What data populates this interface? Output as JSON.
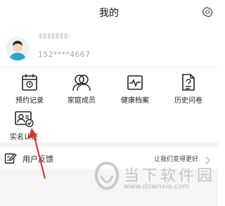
{
  "header": {
    "title": "我的"
  },
  "profile": {
    "phone": "152****4667"
  },
  "grid": [
    {
      "label": "预约记录"
    },
    {
      "label": "家庭成员"
    },
    {
      "label": "健康档案"
    },
    {
      "label": "历史问卷"
    },
    {
      "label": "实名认证"
    }
  ],
  "feedback": {
    "label": "用户反馈",
    "slogan": "让我们变得更好"
  },
  "watermark": {
    "brand": "当下软件园",
    "url": "www.downxia.com"
  },
  "colors": {
    "annotation_arrow": "#e2322f",
    "chevron": "#c8c8c8",
    "band": "#f4f4f4"
  }
}
